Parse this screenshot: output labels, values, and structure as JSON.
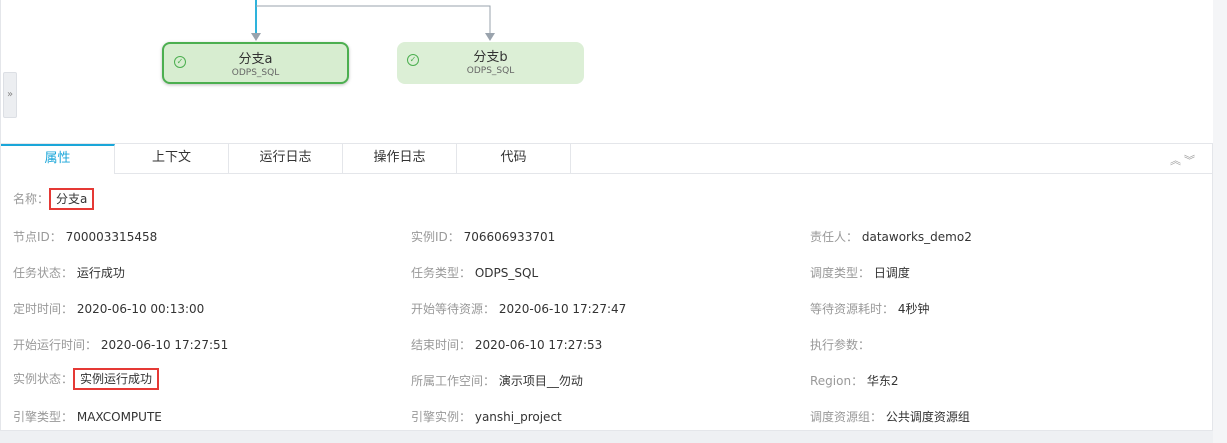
{
  "graph": {
    "nodes": [
      {
        "title": "分支a",
        "type": "ODPS_SQL",
        "status": "success",
        "selected": true
      },
      {
        "title": "分支b",
        "type": "ODPS_SQL",
        "status": "success",
        "selected": false
      }
    ],
    "side_toggle": "»"
  },
  "tabs": [
    {
      "label": "属性",
      "active": true
    },
    {
      "label": "上下文",
      "active": false
    },
    {
      "label": "运行日志",
      "active": false
    },
    {
      "label": "操作日志",
      "active": false
    },
    {
      "label": "代码",
      "active": false
    }
  ],
  "panel_controls": {
    "expand": "︽",
    "collapse": "︾"
  },
  "properties": {
    "name": {
      "label": "名称：",
      "value": "分支a"
    },
    "node_id": {
      "label": "节点ID：",
      "value": "700003315458"
    },
    "instance_id": {
      "label": "实例ID：",
      "value": "706606933701"
    },
    "owner": {
      "label": "责任人：",
      "value": "dataworks_demo2"
    },
    "task_status": {
      "label": "任务状态：",
      "value": "运行成功"
    },
    "task_type": {
      "label": "任务类型：",
      "value": "ODPS_SQL"
    },
    "schedule_type": {
      "label": "调度类型：",
      "value": "日调度"
    },
    "scheduled_time": {
      "label": "定时时间：",
      "value": "2020-06-10 00:13:00"
    },
    "wait_start": {
      "label": "开始等待资源：",
      "value": "2020-06-10 17:27:47"
    },
    "wait_duration": {
      "label": "等待资源耗时：",
      "value": "4秒钟"
    },
    "run_start": {
      "label": "开始运行时间：",
      "value": "2020-06-10 17:27:51"
    },
    "end_time": {
      "label": "结束时间：",
      "value": "2020-06-10 17:27:53"
    },
    "exec_params": {
      "label": "执行参数：",
      "value": ""
    },
    "instance_status": {
      "label": "实例状态：",
      "value": "实例运行成功"
    },
    "workspace": {
      "label": "所属工作空间：",
      "value": "演示项目__勿动"
    },
    "region": {
      "label": "Region：",
      "value": "华东2"
    },
    "engine_type": {
      "label": "引擎类型：",
      "value": "MAXCOMPUTE"
    },
    "engine_instance": {
      "label": "引擎实例：",
      "value": "yanshi_project"
    },
    "resource_group": {
      "label": "调度资源组：",
      "value": "公共调度资源组"
    }
  },
  "colors": {
    "accent": "#1aa6d9",
    "success": "#4caf50",
    "highlight": "#e53935"
  }
}
